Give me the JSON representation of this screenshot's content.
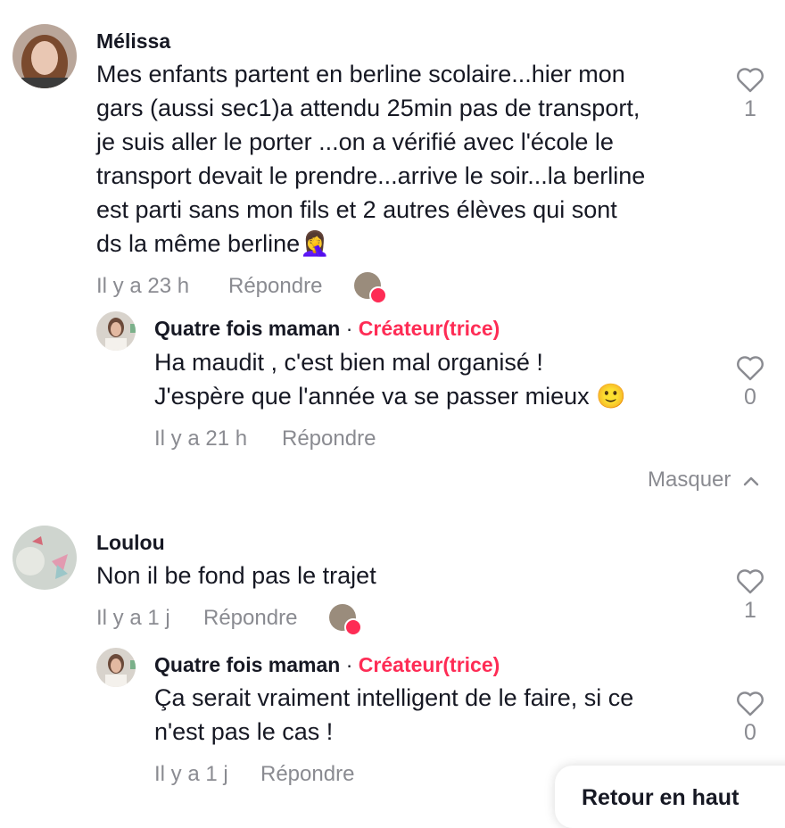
{
  "colors": {
    "creator": "#fe2c55",
    "meta": "#8a8b91",
    "text": "#161823"
  },
  "comments": [
    {
      "author": "Mélissa",
      "text": "Mes enfants partent en berline scolaire...hier mon\ngars (aussi sec1)a attendu 25min pas de transport,\nje suis aller le porter ...on a vérifié avec l'école le\ntransport devait le prendre...arrive le soir...la berline\nest parti sans mon fils et 2 autres élèves qui sont\nds la même berline🤦‍♀️",
      "time": "Il y a 23 h",
      "reply": "Répondre",
      "likes": "1",
      "reply_item": {
        "author": "Quatre fois maman",
        "separator": "·",
        "badge": "Créateur(trice)",
        "text": "Ha maudit , c'est bien mal organisé !\nJ'espère que l'année va se passer mieux 🙂",
        "time": "Il y a 21 h",
        "reply": "Répondre",
        "likes": "0"
      },
      "collapse": "Masquer"
    },
    {
      "author": "Loulou",
      "text": "Non il be fond pas le trajet",
      "time": "Il y a 1 j",
      "reply": "Répondre",
      "likes": "1",
      "reply_item": {
        "author": "Quatre fois maman",
        "separator": "·",
        "badge": "Créateur(trice)",
        "text": "Ça serait vraiment intelligent de le faire, si ce\nn'est pas le cas !",
        "time": "Il y a 1 j",
        "reply": "Répondre",
        "likes": "0"
      }
    }
  ],
  "back_to_top": "Retour en haut"
}
